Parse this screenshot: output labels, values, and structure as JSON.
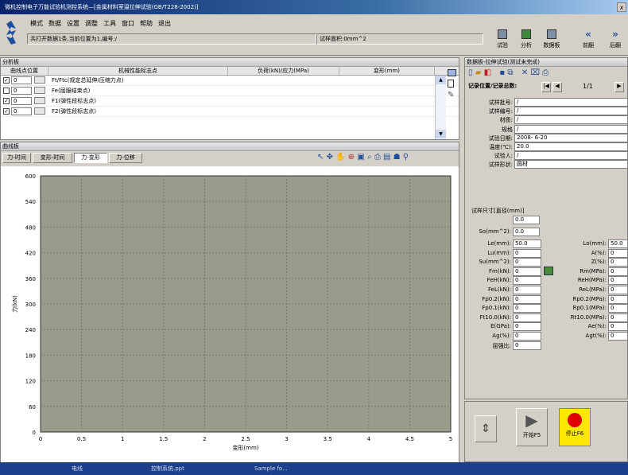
{
  "window": {
    "title": "微机控制电子万能试验机测控系统—[金属材料室温拉伸试验(GB/T228-2002)]",
    "close": "x"
  },
  "menu": [
    "模式",
    "数据",
    "设置",
    "调整",
    "工具",
    "窗口",
    "帮助",
    "退出"
  ],
  "status": {
    "message": "共打开数据1条,当前位置为1,编号:/",
    "area": "试样面积:0mm^2"
  },
  "right_buttons": [
    {
      "icon": "trial-icon",
      "label": "试验"
    },
    {
      "icon": "analysis-icon",
      "label": "分析"
    },
    {
      "icon": "databoard-icon",
      "label": "数据板"
    },
    {
      "icon": "prev-icon",
      "label": "前翻",
      "glyph": "«"
    },
    {
      "icon": "next-icon",
      "label": "后翻",
      "glyph": "»"
    }
  ],
  "analysis": {
    "title": "分析板",
    "headers": [
      "曲线点位置",
      "机械性能标志点",
      "负荷(kN)/应力(MPa)",
      "变形(mm)"
    ],
    "rows": [
      {
        "checked": true,
        "pos": "0",
        "name": "Ft/Ftc(规定总延伸/压缩力点)"
      },
      {
        "checked": false,
        "pos": "0",
        "name": "Fe(屈服结束点)"
      },
      {
        "checked": true,
        "pos": "0",
        "name": "F1(弹性段标志点)"
      },
      {
        "checked": true,
        "pos": "0",
        "name": "F2(弹性段标志点)"
      }
    ]
  },
  "curve": {
    "title": "曲线板",
    "tabs": [
      "力-时间",
      "变形-时间",
      "力-变形",
      "力-位移"
    ],
    "active_tab": 2
  },
  "chart_data": {
    "type": "line",
    "xlabel": "变形(mm)",
    "ylabel": "力(kN)",
    "xlim": [
      0,
      5
    ],
    "ylim": [
      0,
      600
    ],
    "x_ticks": [
      "0",
      "0.5",
      "1",
      "1.5",
      "2",
      "2.5",
      "3",
      "3.5",
      "4",
      "4.5",
      "5"
    ],
    "y_ticks": [
      "0",
      "60",
      "120",
      "180",
      "240",
      "300",
      "360",
      "420",
      "480",
      "540",
      "600"
    ],
    "grid": true,
    "background": "#9b9b8c",
    "series": []
  },
  "data_panel": {
    "title": "数据板-拉伸试验(测试未完成)",
    "nav_label": "记录位置/记录总数:",
    "nav_value": "1/1",
    "fields": [
      {
        "label": "试样批号:",
        "value": "/"
      },
      {
        "label": "试样编号:",
        "value": "/"
      },
      {
        "label": "材质:",
        "value": "/"
      },
      {
        "label": "规格",
        "value": "/"
      },
      {
        "label": "试验日期:",
        "value": "2008- 6-20"
      },
      {
        "label": "温度(℃):",
        "value": "20.0"
      },
      {
        "label": "试验人:",
        "value": "/"
      },
      {
        "label": "试样形状:",
        "value": "圆材"
      }
    ],
    "size_label": "试样尺寸[直径(mm)]",
    "size_value": "0.0",
    "so_label": "So(mm^2):",
    "so_value": "0.0",
    "pairs": [
      {
        "l": "Le(mm):",
        "lv": "50.0",
        "r": "Lo(mm):",
        "rv": "50.0"
      },
      {
        "l": "Lu(mm):",
        "lv": "0",
        "r": "A(%):",
        "rv": "0"
      },
      {
        "l": "Su(mm^2):",
        "lv": "0",
        "r": "Z(%):",
        "rv": "0"
      },
      {
        "l": "Fm(kN):",
        "lv": "0",
        "r": "Rm(MPa):",
        "rv": "0"
      },
      {
        "l": "FeH(kN):",
        "lv": "0",
        "r": "ReH(MPa):",
        "rv": "0"
      },
      {
        "l": "FeL(kN):",
        "lv": "0",
        "r": "ReL(MPa):",
        "rv": "0"
      },
      {
        "l": "Fp0.2(kN):",
        "lv": "0",
        "r": "Rp0.2(MPa):",
        "rv": "0"
      },
      {
        "l": "Fp0.1(kN):",
        "lv": "0",
        "r": "Rp0.1(MPa):",
        "rv": "0"
      },
      {
        "l": "Ft10.0(kN):",
        "lv": "0",
        "r": "Rt10.0(MPa):",
        "rv": "0"
      },
      {
        "l": "E(GPa):",
        "lv": "0",
        "r": "Ae(%):",
        "rv": "0"
      },
      {
        "l": "Ag(%):",
        "lv": "0",
        "r": "Agt(%):",
        "rv": "0"
      },
      {
        "l": "屈强比:",
        "lv": "0",
        "r": "",
        "rv": ""
      }
    ]
  },
  "control": {
    "start_label": "开始F5",
    "stop_label": "停止F6"
  },
  "taskbar": [
    "电线",
    "控制系统.ppt",
    "Sample fo..."
  ]
}
